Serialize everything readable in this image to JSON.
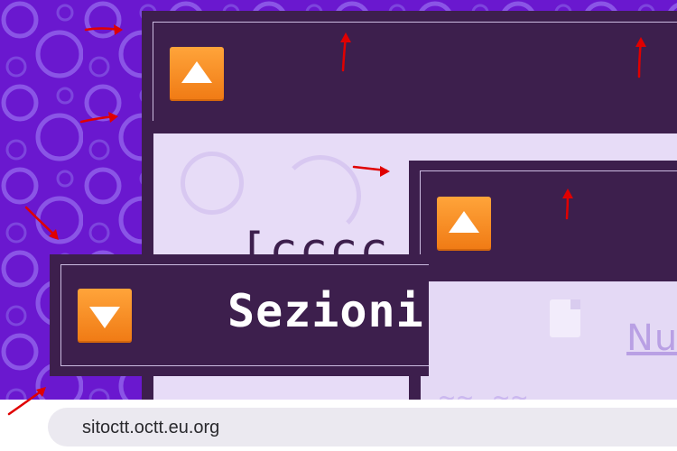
{
  "colors": {
    "background": "#6a18cf",
    "window_frame": "#3d1f4d",
    "content_bg": "#e7dcf7",
    "toggle_button": "#f58a1f",
    "annotation_arrow": "#e00000"
  },
  "back_window": {
    "toggle_icon": "triangle-up-icon",
    "partial_text": "[cccc"
  },
  "right_window": {
    "toggle_icon": "triangle-up-icon",
    "faded_link": "Nu",
    "faded_text": "~~ ~~"
  },
  "front_window": {
    "toggle_icon": "triangle-down-icon",
    "title": "Sezioni"
  },
  "browser": {
    "url": "sitoctt.octt.eu.org"
  }
}
